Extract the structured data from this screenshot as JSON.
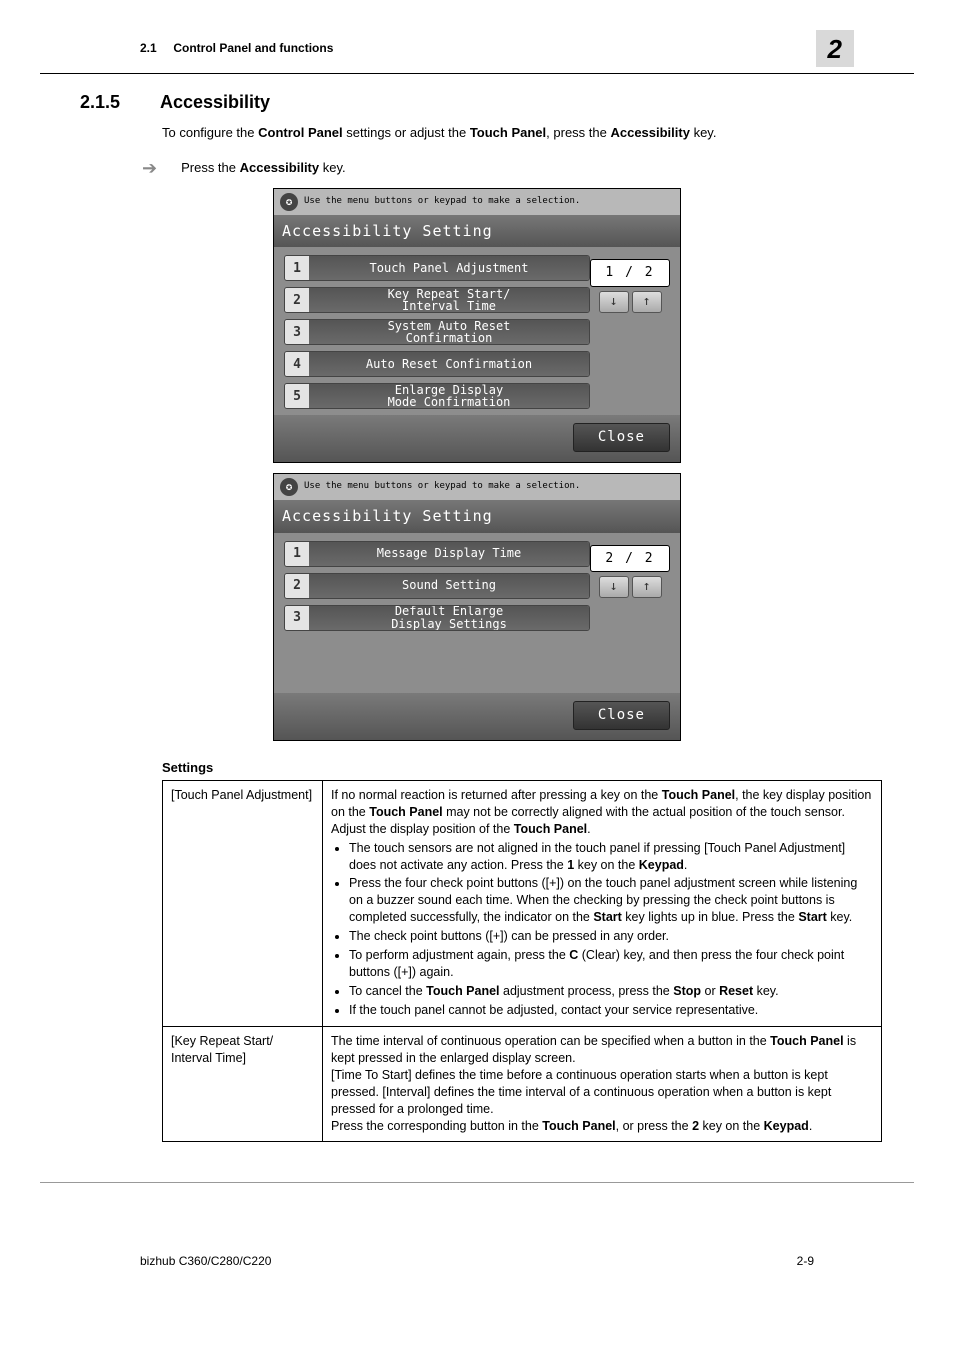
{
  "header": {
    "section_ref": "2.1",
    "section_title": "Control Panel and functions",
    "chapter_badge": "2"
  },
  "section": {
    "number": "2.1.5",
    "title": "Accessibility",
    "intro_prefix": "To configure the ",
    "intro_b1": "Control Panel",
    "intro_mid1": " settings or adjust the ",
    "intro_b2": "Touch Panel",
    "intro_mid2": ", press the ",
    "intro_b3": "Accessibility",
    "intro_end": " key.",
    "step_prefix": "Press the ",
    "step_bold": "Accessibility",
    "step_end": " key."
  },
  "panel_hint": "Use the menu buttons or keypad to make a selection.",
  "panel_title": "Accessibility Setting",
  "panel1": {
    "items": [
      {
        "n": "1",
        "label": "Touch Panel Adjustment"
      },
      {
        "n": "2",
        "label": "Key Repeat Start/\nInterval Time"
      },
      {
        "n": "3",
        "label": "System Auto Reset\nConfirmation"
      },
      {
        "n": "4",
        "label": "Auto Reset Confirmation"
      },
      {
        "n": "5",
        "label": "Enlarge Display\nMode Confirmation"
      }
    ],
    "page": "1 / 2",
    "close": "Close"
  },
  "panel2": {
    "items": [
      {
        "n": "1",
        "label": "Message Display Time"
      },
      {
        "n": "2",
        "label": "Sound Setting"
      },
      {
        "n": "3",
        "label": "Default Enlarge\nDisplay Settings"
      }
    ],
    "page": "2 / 2",
    "close": "Close"
  },
  "settings": {
    "heading": "Settings",
    "rows": [
      {
        "name": "[Touch Panel Adjustment]",
        "lead": "If no normal reaction is returned after pressing a key on the <b>Touch Panel</b>, the key display position on the <b>Touch Panel</b> may not be correctly aligned with the actual position of the touch sensor.<br>Adjust the display position of the <b>Touch Panel</b>.",
        "bullets": [
          "The touch sensors are not aligned in the touch panel if pressing [Touch Panel Adjustment] does not activate any action. Press the <b>1</b> key on the <b>Keypad</b>.",
          "Press the four check point buttons ([+]) on the touch panel adjustment screen while listening on a buzzer sound each time. When the checking by pressing the check point buttons is completed successfully, the indicator on the <b>Start</b> key lights up in blue. Press the <b>Start</b> key.",
          "The check point buttons ([+]) can be pressed in any order.",
          "To perform adjustment again, press the <b>C</b> (Clear) key, and then press the four check point buttons ([+]) again.",
          "To cancel the <b>Touch Panel</b> adjustment process, press the <b>Stop</b> or <b>Reset</b> key.",
          "If the touch panel cannot be adjusted, contact your service representative."
        ]
      },
      {
        "name": "[Key Repeat Start/ Interval Time]",
        "lead": "The time interval of continuous operation can be specified when a button in the <b>Touch Panel</b> is kept pressed in the enlarged display screen.<br>[Time To Start] defines the time before a continuous operation starts when a button is kept pressed. [Interval] defines the time interval of a continuous operation when a button is kept pressed for a prolonged time.<br>Press the corresponding button in the <b>Touch Panel</b>, or press the <b>2</b> key on the <b>Keypad</b>.",
        "bullets": []
      }
    ]
  },
  "footer": {
    "left": "bizhub C360/C280/C220",
    "right": "2-9"
  }
}
